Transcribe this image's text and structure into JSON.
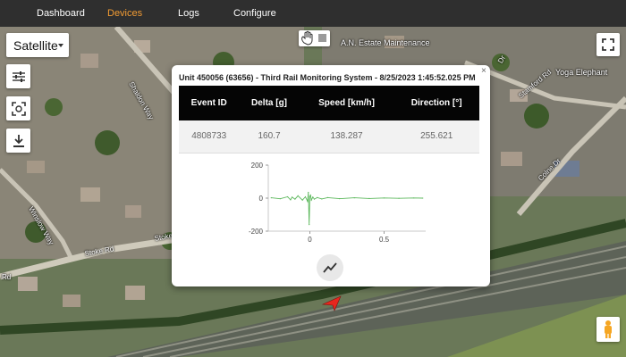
{
  "nav": {
    "items": [
      {
        "label": "Dashboard",
        "active": false
      },
      {
        "label": "Devices",
        "active": true
      },
      {
        "label": "Logs",
        "active": false
      },
      {
        "label": "Configure",
        "active": false
      }
    ]
  },
  "map": {
    "type_selector": "Satellite",
    "labels": {
      "estate": "A.N. Estate Maintenance",
      "yoga": "Yoga Elephant",
      "shaldon": "Shaldon Way",
      "stamford": "Stamford Rd",
      "colne": "Colne Dr",
      "winslow": "Winslow Way",
      "stoke1": "Stoke Rd",
      "stoke2": "Stoke Rd",
      "rd_left": "Rd",
      "dr_top": "Dr"
    },
    "controls": {
      "filter_icon": "tune-icon",
      "focus_icon": "center-focus-icon",
      "download_icon": "download-icon",
      "fullscreen_icon": "fullscreen-icon",
      "pegman_icon": "street-view-pegman-icon",
      "hand_icon": "hand-pan-icon",
      "stop_icon": "square-draw-icon"
    }
  },
  "popup": {
    "title": "Unit 450056 (63656) - Third Rail Monitoring System - 8/25/2023 1:45:52.025 PM",
    "close": "×",
    "table": {
      "headers": [
        "Event ID",
        "Delta [g]",
        "Speed [km/h]",
        "Direction [°]"
      ],
      "row": [
        "4808733",
        "160.7",
        "138.287",
        "255.621"
      ]
    },
    "chart_button_icon": "trend-chart-icon"
  },
  "chart_data": {
    "type": "line",
    "title": "",
    "xlabel": "",
    "ylabel": "",
    "xlim": [
      -0.28,
      0.78
    ],
    "ylim": [
      -200,
      200
    ],
    "x_ticks": [
      "0",
      "0.5"
    ],
    "y_ticks": [
      "200",
      "0",
      "-200"
    ],
    "series": [
      {
        "color": "#5cb85c",
        "x": [
          -0.26,
          -0.2,
          -0.15,
          -0.13,
          -0.12,
          -0.1,
          -0.08,
          -0.05,
          -0.03,
          -0.015,
          -0.01,
          -0.005,
          0.0,
          0.005,
          0.01,
          0.02,
          0.03,
          0.05,
          0.08,
          0.12,
          0.2,
          0.3,
          0.4,
          0.5,
          0.6,
          0.7,
          0.76
        ],
        "y": [
          2,
          -4,
          8,
          -10,
          6,
          -6,
          14,
          -12,
          8,
          -20,
          35,
          -160,
          10,
          18,
          -12,
          6,
          -6,
          4,
          -5,
          3,
          -3,
          2,
          -2,
          1,
          -1,
          1,
          0
        ]
      }
    ]
  }
}
